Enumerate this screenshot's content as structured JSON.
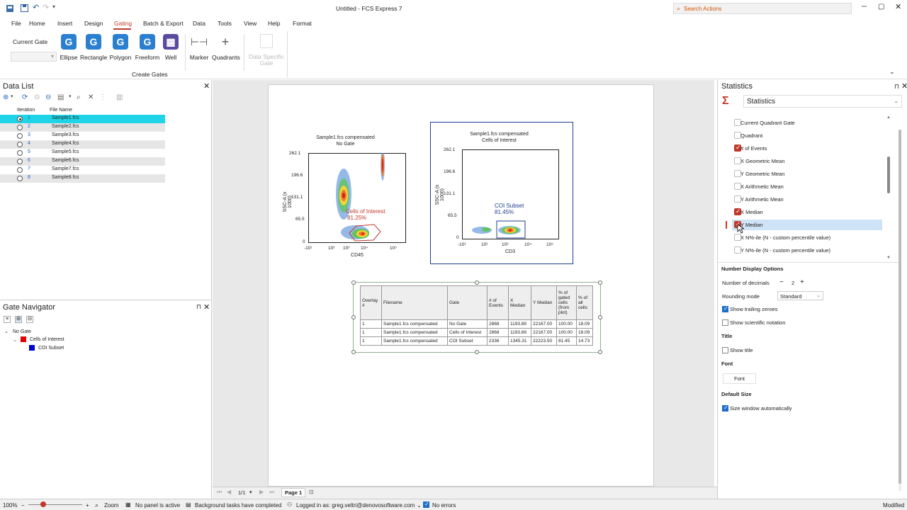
{
  "window": {
    "title": "Untitled - FCS Express 7",
    "search_placeholder": "Search Actions",
    "status_right": "Modified"
  },
  "menu": [
    "File",
    "Home",
    "Insert",
    "Design",
    "Gating",
    "Batch & Export",
    "Data",
    "Tools",
    "View",
    "Help",
    "Format"
  ],
  "ribbon": {
    "current_gate": "Current Gate",
    "buttons": [
      "Ellipse",
      "Rectangle",
      "Polygon",
      "Freeform",
      "Well",
      "Marker",
      "Quadrants"
    ],
    "data_specific_gate": "Data Specific Gate",
    "group_label": "Create Gates"
  },
  "data_list": {
    "title": "Data List",
    "headers": [
      "Iteration",
      "File Name"
    ],
    "rows": [
      {
        "it": "1",
        "file": "Sample1.fcs"
      },
      {
        "it": "2",
        "file": "Sample2.fcs"
      },
      {
        "it": "3",
        "file": "Sample3.fcs"
      },
      {
        "it": "4",
        "file": "Sample4.fcs"
      },
      {
        "it": "5",
        "file": "Sample5.fcs"
      },
      {
        "it": "6",
        "file": "Sample6.fcs"
      },
      {
        "it": "7",
        "file": "Sample7.fcs"
      },
      {
        "it": "8",
        "file": "Sample8.fcs"
      }
    ]
  },
  "gate_navigator": {
    "title": "Gate Navigator",
    "items": [
      "No Gate",
      "Cells of Interest",
      "COI Subset"
    ],
    "colors": [
      "#e60000",
      "#0000cc"
    ]
  },
  "plot1": {
    "title1": "Sample1.fcs compensated",
    "title2": "No Gate",
    "ylabel": "SSC-A (x 1000)",
    "xlabel": "CD45",
    "yticks": [
      "262.1",
      "196.6",
      "131.1",
      "65.5",
      "0"
    ],
    "xticks": [
      "-10¹",
      "10²",
      "10³",
      "10⁴",
      "10⁵"
    ],
    "gate_label": "Cells of Interest",
    "gate_pct": "81.25%"
  },
  "plot2": {
    "title1": "Sample1.fcs compensated",
    "title2": "Cells of Interest",
    "ylabel": "SSC-A (x 1000)",
    "xlabel": "CD3",
    "yticks": [
      "262.1",
      "196.6",
      "131.1",
      "65.5",
      "0"
    ],
    "xticks": [
      "-10¹",
      "10²",
      "10³",
      "10⁴",
      "10⁵"
    ],
    "gate_label": "COI Subset",
    "gate_pct": "81.45%"
  },
  "stats_table": {
    "headers": [
      "Overlay #",
      "Filename",
      "Gate",
      "# of Events",
      "X Median",
      "Y Median",
      "% of gated cells (from plot)",
      "% of all cells"
    ],
    "rows": [
      [
        "1",
        "Sample1.fcs compensated",
        "No Gate",
        "2868",
        "1193.89",
        "22167.00",
        "100.00",
        "18.09"
      ],
      [
        "1",
        "Sample1.fcs compensated",
        "Cells of Interest",
        "2868",
        "1193.89",
        "22167.00",
        "100.00",
        "18.09"
      ],
      [
        "1",
        "Sample1.fcs compensated",
        "COI Subset",
        "2336",
        "1345.31",
        "22223.50",
        "81.45",
        "14.73"
      ]
    ]
  },
  "statistics": {
    "panel_title": "Statistics",
    "dropdown": "Statistics",
    "items": [
      {
        "label": "Current Quadrant Gate",
        "on": false
      },
      {
        "label": "Quadrant",
        "on": false
      },
      {
        "label": "# of Events",
        "on": true
      },
      {
        "label": "X Geometric Mean",
        "on": false
      },
      {
        "label": "Y Geometric Mean",
        "on": false
      },
      {
        "label": "X Arithmetic Mean",
        "on": false
      },
      {
        "label": "Y Arithmetic Mean",
        "on": false
      },
      {
        "label": "X Median",
        "on": true
      },
      {
        "label": "Y Median",
        "on": true
      },
      {
        "label": "X N%-ile (N - custom percentile value)",
        "on": false
      },
      {
        "label": "Y N%-ile (N - custom percentile value)",
        "on": false
      }
    ],
    "number_display_options": "Number Display Options",
    "number_of_decimals_label": "Number of decimals",
    "number_of_decimals": "2",
    "rounding_mode_label": "Rounding mode",
    "rounding_mode": "Standard",
    "show_trailing_zeroes": "Show trailing zeroes",
    "show_scientific": "Show scientific notation",
    "title_section": "Title",
    "show_title": "Show title",
    "font_section": "Font",
    "font_button": "Font",
    "default_size_section": "Default Size",
    "size_window": "Size window automatically"
  },
  "pager": {
    "pages": "1/1",
    "page_tab": "Page 1"
  },
  "status": {
    "zoom": "100%",
    "zoom_label": "Zoom",
    "panel": "No panel is active",
    "tasks": "Background tasks have completed",
    "login": "Logged in as: greg.veltri@denovosoftware.com",
    "errors": "No errors"
  }
}
